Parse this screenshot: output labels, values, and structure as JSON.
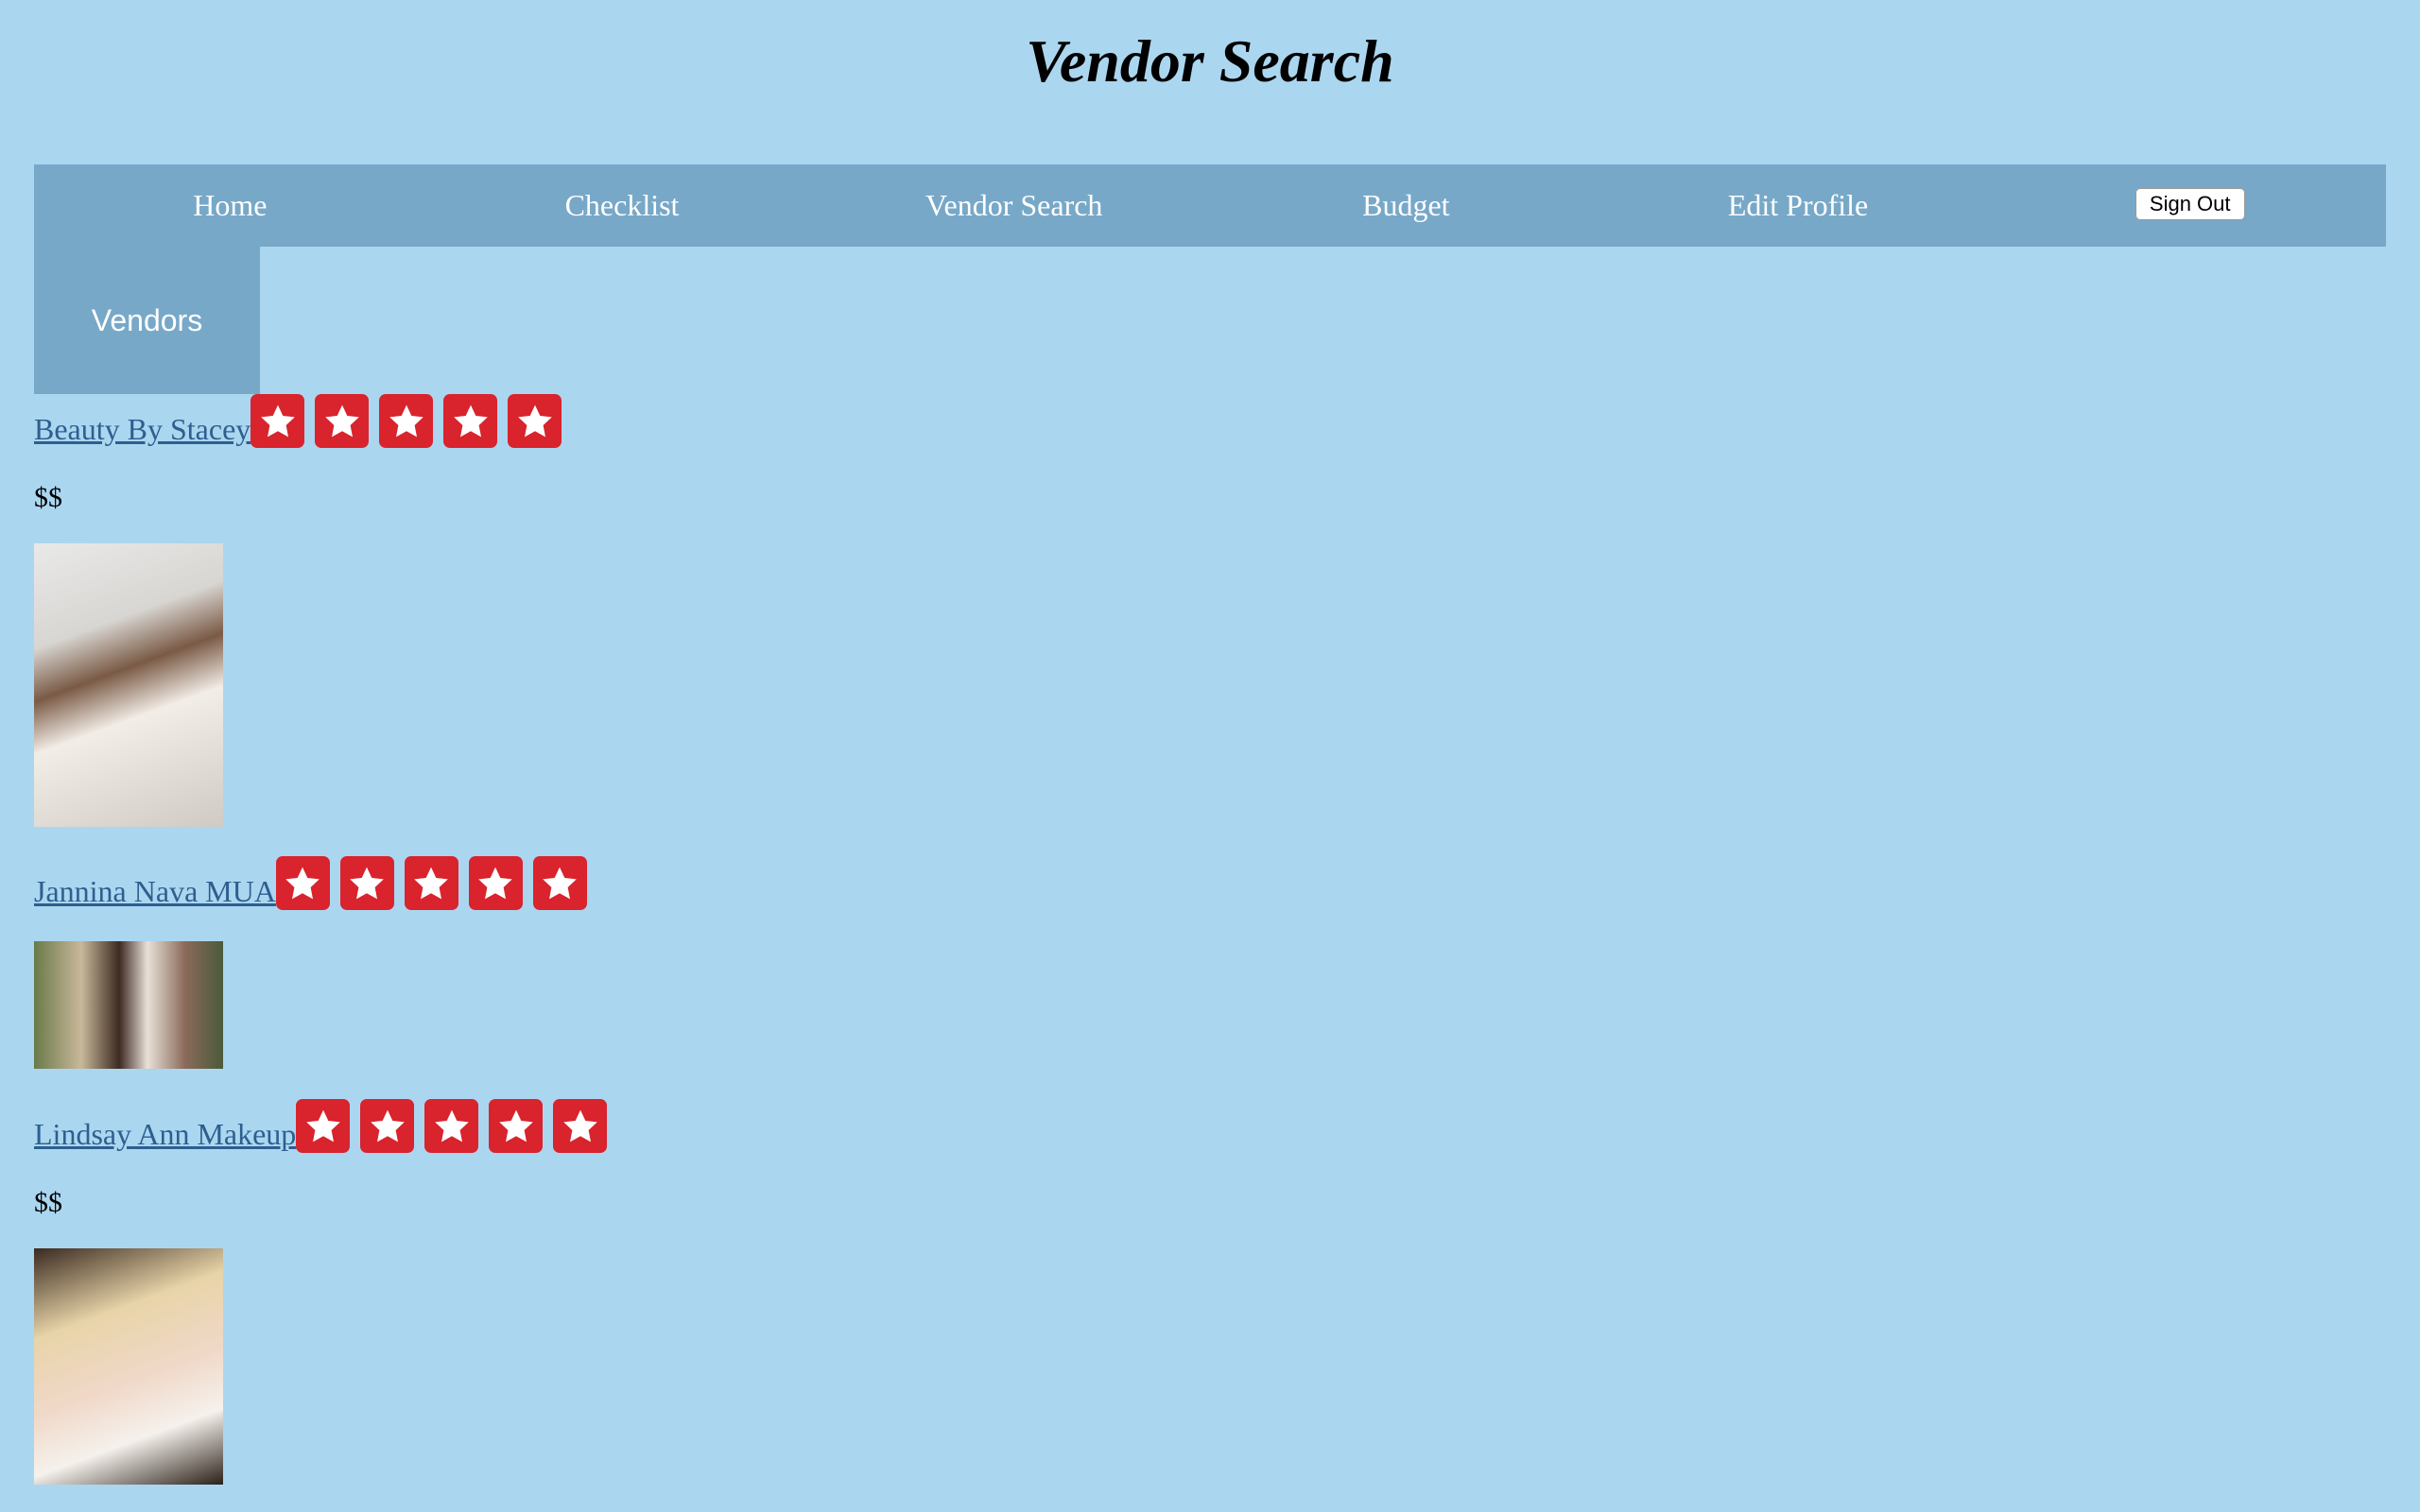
{
  "page": {
    "title": "Vendor Search"
  },
  "nav": {
    "items": [
      {
        "label": "Home"
      },
      {
        "label": "Checklist"
      },
      {
        "label": "Vendor Search"
      },
      {
        "label": "Budget"
      },
      {
        "label": "Edit Profile"
      }
    ],
    "sign_out_label": "Sign Out"
  },
  "category_tab": {
    "label": "Vendors"
  },
  "vendors": [
    {
      "name": "Beauty By Stacey",
      "rating": 5,
      "price": "$$",
      "photo_icon": "bride-portrait-image"
    },
    {
      "name": "Jannina Nava MUA",
      "rating": 5,
      "price": "",
      "photo_icon": "wedding-ceremony-image"
    },
    {
      "name": "Lindsay Ann Makeup",
      "rating": 5,
      "price": "$$",
      "photo_icon": "bride-portrait-image"
    }
  ],
  "colors": {
    "background": "#abd6f0",
    "nav_background": "#78a8c8",
    "star_badge": "#d9232d",
    "link": "#2d5f8f"
  }
}
